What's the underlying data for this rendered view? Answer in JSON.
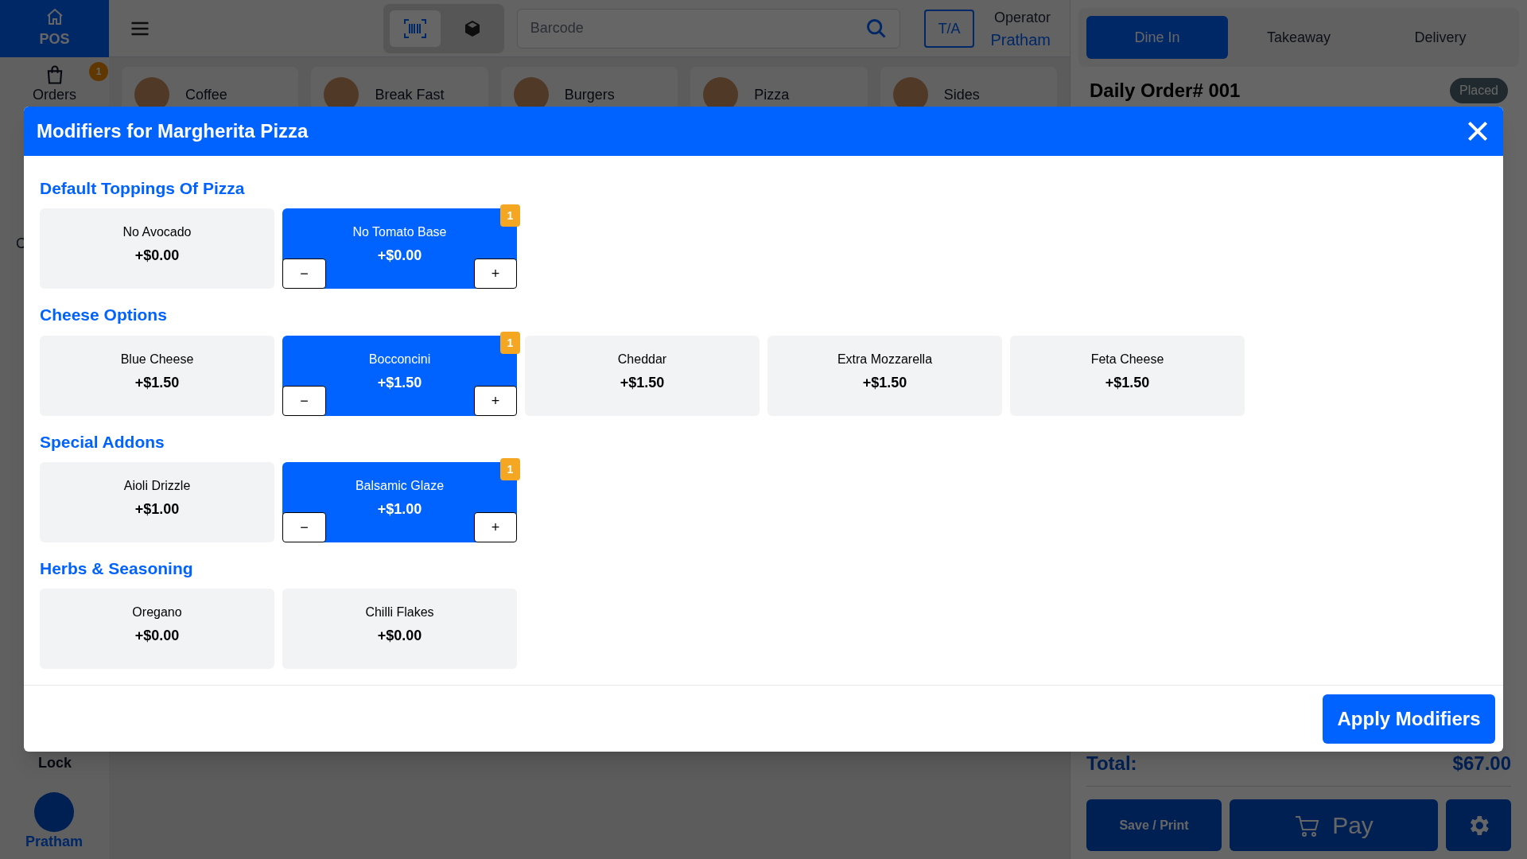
{
  "sidebar": {
    "home": {
      "label": "POS",
      "selected": true
    },
    "orders": {
      "label": "Orders",
      "badge": "1"
    },
    "partial_item": "C",
    "lock": "Lock",
    "user": "Pratham"
  },
  "topbar": {
    "scan_modes": [
      {
        "kind": "barcode",
        "selected": true
      },
      {
        "kind": "box",
        "selected": false
      }
    ],
    "search": {
      "placeholder": "Barcode"
    },
    "ta_button": "T/A",
    "operator_label": "Operator",
    "operator_name": "Pratham"
  },
  "categories": [
    {
      "label": "Coffee"
    },
    {
      "label": "Break Fast"
    },
    {
      "label": "Burgers"
    },
    {
      "label": "Pizza"
    },
    {
      "label": "Sides"
    }
  ],
  "order_panel": {
    "tabs": [
      {
        "label": "Dine In",
        "selected": true
      },
      {
        "label": "Takeaway",
        "selected": false
      },
      {
        "label": "Delivery",
        "selected": false
      }
    ],
    "title": "Daily Order# 001",
    "status": "Placed",
    "total_label": "Total:",
    "total": "$67.00",
    "save_button": "Save / Print",
    "pay_button": "Pay"
  },
  "modal": {
    "title": "Modifiers for Margherita Pizza",
    "groups": [
      {
        "title": "Default Toppings Of Pizza",
        "options": [
          {
            "name": "No Avocado",
            "price": "+$0.00",
            "selected": false
          },
          {
            "name": "No Tomato Base",
            "price": "+$0.00",
            "selected": true,
            "quantity": "1",
            "minus": "−",
            "plus": "+"
          }
        ]
      },
      {
        "title": "Cheese Options",
        "options": [
          {
            "name": "Blue Cheese",
            "price": "+$1.50",
            "selected": false
          },
          {
            "name": "Bocconcini",
            "price": "+$1.50",
            "selected": true,
            "quantity": "1",
            "minus": "−",
            "plus": "+"
          },
          {
            "name": "Cheddar",
            "price": "+$1.50",
            "selected": false
          },
          {
            "name": "Extra Mozzarella",
            "price": "+$1.50",
            "selected": false
          },
          {
            "name": "Feta Cheese",
            "price": "+$1.50",
            "selected": false
          }
        ]
      },
      {
        "title": "Special Addons",
        "options": [
          {
            "name": "Aioli Drizzle",
            "price": "+$1.00",
            "selected": false
          },
          {
            "name": "Balsamic Glaze",
            "price": "+$1.00",
            "selected": true,
            "quantity": "1",
            "minus": "−",
            "plus": "+"
          }
        ]
      },
      {
        "title": "Herbs & Seasoning",
        "options": [
          {
            "name": "Oregano",
            "price": "+$0.00",
            "selected": false
          },
          {
            "name": "Chilli Flakes",
            "price": "+$0.00",
            "selected": false
          }
        ]
      }
    ],
    "apply_button": "Apply Modifiers"
  }
}
